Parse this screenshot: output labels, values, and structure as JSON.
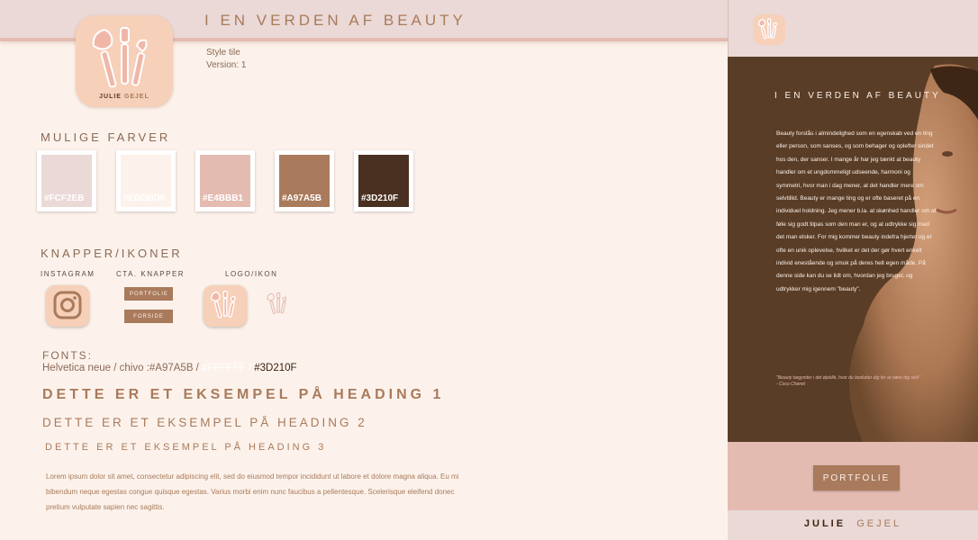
{
  "header": {
    "title": "I EN VERDEN AF BEAUTY",
    "style_tile": "Style tile",
    "version": "Version: 1"
  },
  "logo": {
    "brand_first": "JULIE",
    "brand_second": "GEJEL"
  },
  "colors_section": {
    "title": "MULIGE FARVER",
    "swatches": [
      {
        "hex": "#FCF2EB",
        "color": "#ead9d6"
      },
      {
        "hex": "#EDDBD6",
        "color": "#fcf2eb"
      },
      {
        "hex": "#E4BBB1",
        "color": "#e4bbb1"
      },
      {
        "hex": "#A97A5B",
        "color": "#a97a5b"
      },
      {
        "hex": "#3D210F",
        "color": "#4a3020"
      }
    ]
  },
  "buttons_section": {
    "title": "KNAPPER/IKONER",
    "instagram_label": "INSTAGRAM",
    "cta_label": "CTA. KNAPPER",
    "logo_label": "LOGO/IKON",
    "cta_portfolie": "PORTFOLIE",
    "cta_forside": "FORSIDE"
  },
  "fonts_section": {
    "title": "FONTS:",
    "line_prefix": "Helvetica neue / chivo :#A97A5B / ",
    "white_hex": "#FFFFFF",
    "sep": " / ",
    "dark_hex": "#3D210F"
  },
  "headings": {
    "h1": "DETTE ER ET EKSEMPEL PÅ HEADING 1",
    "h2": "DETTE ER ET EKSEMPEL PÅ HEADING 2",
    "h3": "DETTE ER ET EKSEMPEL PÅ HEADING 3"
  },
  "lorem": "Lorem ipsum dolor sit amet, consectetur adipiscing elit, sed do eiusmod tempor incididunt ut labore et dolore magna aliqua. Eu mi bibendum neque egestas congue quisque egestas. Varius morbi enim nunc faucibus a pellentesque. Scelerisque eleifend donec pretium vulputate sapien nec sagittis.",
  "preview": {
    "hero_title": "I EN VERDEN AF BEAUTY",
    "hero_body": "Beauty forstås i almindelighed som en egenskab ved en ting eller person, som sanses, og som behager og oplefter sindet hos den, der sanser. I mange år har jeg tænkt at beauty handler om et ungdommeligt udseende, harmoni og symmetri, hvor man i dag mener, at det handler mere om selvtillid. Beauty er mange ting og er ofte baseret på en individuel holdning. Jeg mener b.la. at skønhed handler om at føle sig godt tilpas som den man er, og at udtrykke sig med det man elsker. For mig kommer beauty indefra hjertet og er ofte en unik oplevelse, hvilket er det der gør hvert enkelt individ enestående og smuk på deres helt egen måde. På denne side kan du se lidt om, hvordan jeg bruger, og udtrykker mig igennem \"beauty\".",
    "quote": "\"Beauty begynder i det øjeblik, hvor du beslutter dig for at være dig selv\"",
    "quote_author": "- Coco Chanel",
    "button": "PORTFOLIE",
    "footer_first": "JULIE",
    "footer_second": "GEJEL"
  }
}
